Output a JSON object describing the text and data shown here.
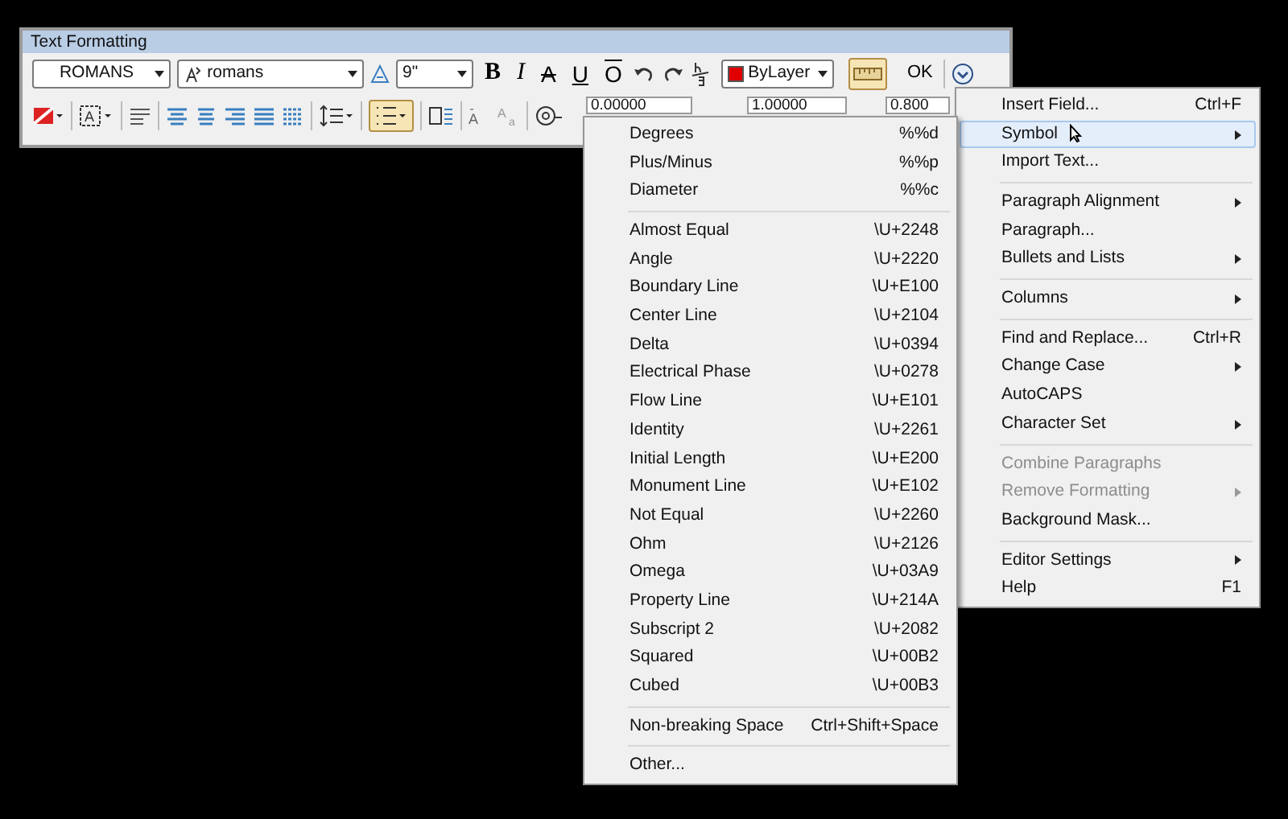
{
  "window": {
    "title": "Text Formatting"
  },
  "row_1": {
    "style_select": "ROMANS",
    "font_select": "romans",
    "height_combo": "9\"",
    "format_buttons": [
      {
        "label": "B",
        "kind": "bold"
      },
      {
        "label": "I",
        "kind": "italic"
      },
      {
        "label": "A",
        "kind": "strike"
      },
      {
        "label": "U",
        "kind": "underline"
      },
      {
        "label": "O",
        "kind": "overline"
      }
    ],
    "color_select": {
      "label": "ByLayer",
      "color": "#e00000"
    },
    "ruler_pressed": true,
    "ok_button": "OK"
  },
  "row_2": {
    "justification_glyph": "A",
    "numbering_pressed": true,
    "uppercase_glyph": "A",
    "lowercase_glyphs": [
      "A",
      "a"
    ],
    "oblique": "0.00000",
    "tracking": "1.00000",
    "width_factor": "0.800"
  },
  "context_menu": {
    "groups": [
      [
        {
          "label": "Insert Field...",
          "shortcut": "Ctrl+F",
          "submenu": false,
          "disabled": false,
          "selected": false
        },
        {
          "label": "Symbol",
          "submenu": true,
          "disabled": false,
          "selected": true
        },
        {
          "label": "Import Text...",
          "submenu": false,
          "disabled": false,
          "selected": false
        }
      ],
      [
        {
          "label": "Paragraph Alignment",
          "submenu": true,
          "disabled": false,
          "selected": false
        },
        {
          "label": "Paragraph...",
          "submenu": false,
          "disabled": false,
          "selected": false
        },
        {
          "label": "Bullets and Lists",
          "submenu": true,
          "disabled": false,
          "selected": false
        }
      ],
      [
        {
          "label": "Columns",
          "submenu": true,
          "disabled": false,
          "selected": false
        }
      ],
      [
        {
          "label": "Find and Replace...",
          "shortcut": "Ctrl+R",
          "submenu": false,
          "disabled": false,
          "selected": false
        },
        {
          "label": "Change Case",
          "submenu": true,
          "disabled": false,
          "selected": false
        },
        {
          "label": "AutoCAPS",
          "submenu": false,
          "disabled": false,
          "selected": false
        },
        {
          "label": "Character Set",
          "submenu": true,
          "disabled": false,
          "selected": false
        }
      ],
      [
        {
          "label": "Combine Paragraphs",
          "submenu": false,
          "disabled": true,
          "selected": false
        },
        {
          "label": "Remove Formatting",
          "submenu": true,
          "disabled": true,
          "selected": false
        },
        {
          "label": "Background Mask...",
          "submenu": false,
          "disabled": false,
          "selected": false
        }
      ],
      [
        {
          "label": "Editor Settings",
          "submenu": true,
          "disabled": false,
          "selected": false
        },
        {
          "label": "Help",
          "shortcut": "F1",
          "submenu": false,
          "disabled": false,
          "selected": false
        }
      ]
    ]
  },
  "symbol_menu": {
    "groups": [
      [
        {
          "label": "Degrees",
          "shortcut": "%%d"
        },
        {
          "label": "Plus/Minus",
          "shortcut": "%%p"
        },
        {
          "label": "Diameter",
          "shortcut": "%%c"
        }
      ],
      [
        {
          "label": "Almost Equal",
          "shortcut": "\\U+2248"
        },
        {
          "label": "Angle",
          "shortcut": "\\U+2220"
        },
        {
          "label": "Boundary Line",
          "shortcut": "\\U+E100"
        },
        {
          "label": "Center Line",
          "shortcut": "\\U+2104"
        },
        {
          "label": "Delta",
          "shortcut": "\\U+0394"
        },
        {
          "label": "Electrical Phase",
          "shortcut": "\\U+0278"
        },
        {
          "label": "Flow Line",
          "shortcut": "\\U+E101"
        },
        {
          "label": "Identity",
          "shortcut": "\\U+2261"
        },
        {
          "label": "Initial Length",
          "shortcut": "\\U+E200"
        },
        {
          "label": "Monument Line",
          "shortcut": "\\U+E102"
        },
        {
          "label": "Not Equal",
          "shortcut": "\\U+2260"
        },
        {
          "label": "Ohm",
          "shortcut": "\\U+2126"
        },
        {
          "label": "Omega",
          "shortcut": "\\U+03A9"
        },
        {
          "label": "Property Line",
          "shortcut": "\\U+214A"
        },
        {
          "label": "Subscript 2",
          "shortcut": "\\U+2082"
        },
        {
          "label": "Squared",
          "shortcut": "\\U+00B2"
        },
        {
          "label": "Cubed",
          "shortcut": "\\U+00B3"
        }
      ],
      [
        {
          "label": "Non-breaking Space",
          "shortcut": "Ctrl+Shift+Space"
        }
      ],
      [
        {
          "label": "Other..."
        }
      ]
    ]
  }
}
